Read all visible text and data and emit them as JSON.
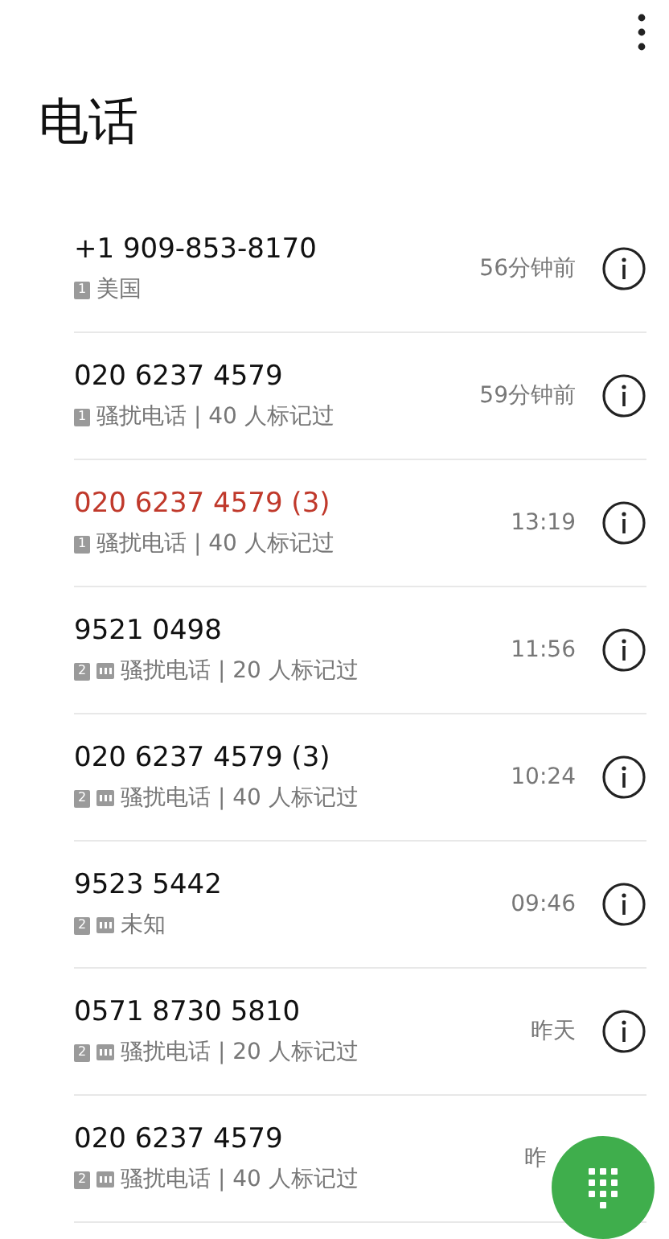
{
  "title": "电话",
  "calls": [
    {
      "number": "+1 909-853-8170",
      "sim": "1",
      "hd": false,
      "missed": false,
      "detail": "美国",
      "time": "56分钟前",
      "info": true
    },
    {
      "number": "020 6237 4579",
      "sim": "1",
      "hd": false,
      "missed": false,
      "detail": "骚扰电话 | 40 人标记过",
      "time": "59分钟前",
      "info": true
    },
    {
      "number": "020 6237 4579 (3)",
      "sim": "1",
      "hd": false,
      "missed": true,
      "detail": "骚扰电话 | 40 人标记过",
      "time": "13:19",
      "info": true
    },
    {
      "number": "9521 0498",
      "sim": "2",
      "hd": true,
      "missed": false,
      "detail": "骚扰电话 | 20 人标记过",
      "time": "11:56",
      "info": true
    },
    {
      "number": "020 6237 4579 (3)",
      "sim": "2",
      "hd": true,
      "missed": false,
      "detail": "骚扰电话 | 40 人标记过",
      "time": "10:24",
      "info": true
    },
    {
      "number": "9523 5442",
      "sim": "2",
      "hd": true,
      "missed": false,
      "detail": "未知",
      "time": "09:46",
      "info": true
    },
    {
      "number": "0571 8730 5810",
      "sim": "2",
      "hd": true,
      "missed": false,
      "detail": "骚扰电话 | 20 人标记过",
      "time": "昨天",
      "info": true
    },
    {
      "number": "020 6237 4579",
      "sim": "2",
      "hd": true,
      "missed": false,
      "detail": "骚扰电话 | 40 人标记过",
      "time": "昨",
      "info": false
    }
  ]
}
